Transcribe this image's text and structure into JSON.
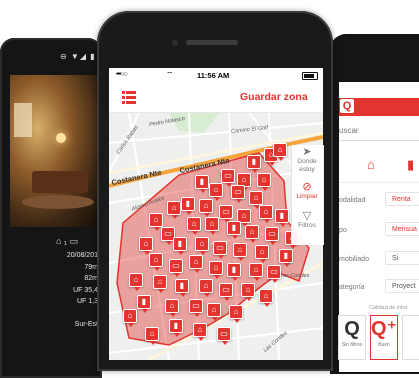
{
  "left_phone": {
    "status_icons": "⊖ ▼◢ ▮",
    "info_rows": [
      "20/08/201",
      "79m",
      "82m",
      "UF 35,4",
      "UF 1,3",
      "",
      "Sur-Est"
    ]
  },
  "center_phone": {
    "status": {
      "signal": "•••○○",
      "time": "11:56 AM"
    },
    "appbar": {
      "title": "Guardar zona"
    },
    "side_tools": [
      {
        "name": "donde-estoy",
        "icon": "navigation-icon",
        "label": "Donde\nestoy"
      },
      {
        "name": "limpiar",
        "icon": "clear-icon",
        "label": "Limpiar"
      },
      {
        "name": "filtros",
        "icon": "filter-icon",
        "label": "Filtros"
      }
    ],
    "map": {
      "streets": [
        "Costanera Nte",
        "Costanera Nte",
        "Pedro Nolasco",
        "Carlos Rabas",
        "Alonso Avalos",
        "Camino El Golf",
        "Alto Las Condes",
        "Las Condes"
      ]
    }
  },
  "right_phone": {
    "logo": "Q",
    "search": "uscar",
    "rows": [
      {
        "label": "odalidad",
        "value": "Renta"
      },
      {
        "label": "po",
        "value": "Mensua"
      },
      {
        "label": "mobiliado",
        "value": "Si"
      },
      {
        "label": "ategoría",
        "value": "Proyect"
      }
    ],
    "quality_title": "Calidad de infor",
    "quality": [
      {
        "icon": "Q",
        "label": "Sin filtros"
      },
      {
        "icon": "Q⁺",
        "label": "Buen"
      }
    ]
  }
}
